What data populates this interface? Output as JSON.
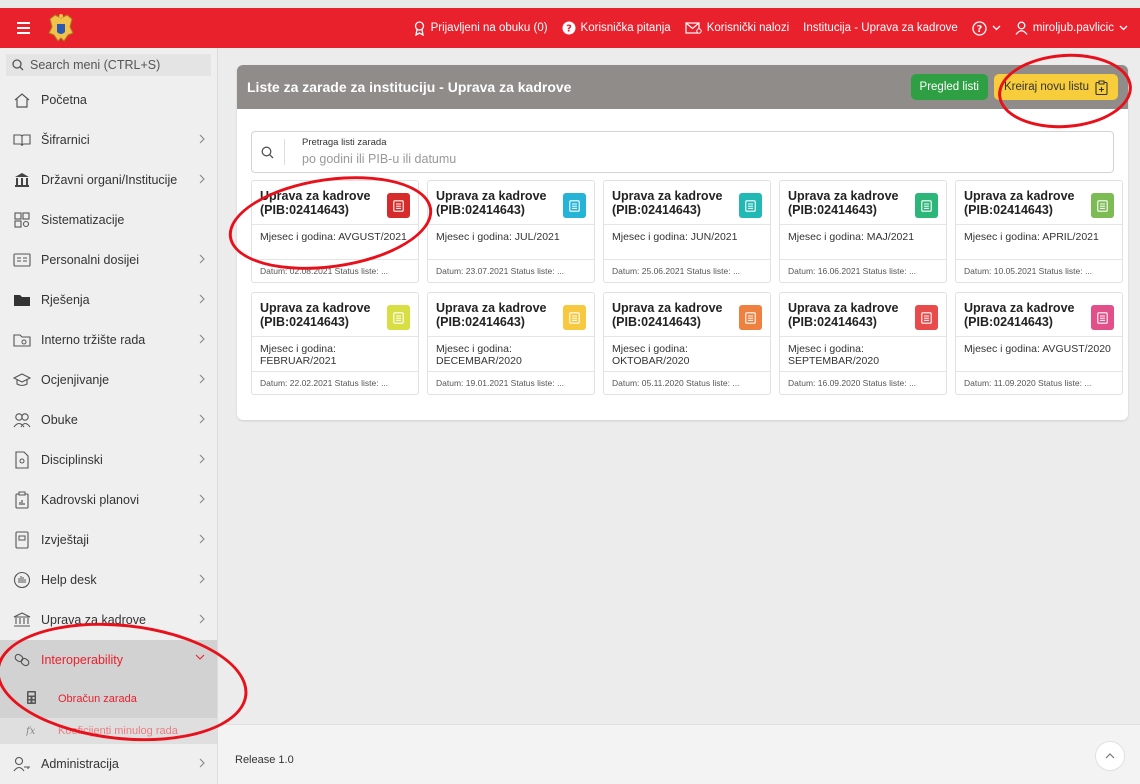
{
  "topbar": {
    "links": [
      {
        "name": "trainings-link",
        "icon": "award-icon",
        "label": "Prijavljeni na obuku (0)"
      },
      {
        "name": "questions-link",
        "icon": "question-circle-icon",
        "label": "Korisnička pitanja"
      },
      {
        "name": "accounts-link",
        "icon": "user-mail-icon",
        "label": "Korisnički nalozi"
      },
      {
        "name": "institution-link",
        "icon": "",
        "label": "Institucija - Uprava za kadrove"
      }
    ],
    "user": "miroljub.pavlicic"
  },
  "sidebar": {
    "search_placeholder": "Search meni (CTRL+S)",
    "items": [
      {
        "name": "sidebar-item-pocetna",
        "icon": "home-icon",
        "label": "Početna",
        "chevron": false
      },
      {
        "name": "sidebar-item-sifrarnici",
        "icon": "book-icon",
        "label": "Šifrarnici",
        "chevron": true
      },
      {
        "name": "sidebar-item-drzavni-organi",
        "icon": "building-icon",
        "label": "Državni organi/Institucije",
        "chevron": true
      },
      {
        "name": "sidebar-item-sistematizacije",
        "icon": "org-search-icon",
        "label": "Sistematizacije",
        "chevron": false
      },
      {
        "name": "sidebar-item-personalni-dosijei",
        "icon": "id-card-icon",
        "label": "Personalni dosijei",
        "chevron": true
      },
      {
        "name": "sidebar-item-rjesenja",
        "icon": "folder-icon",
        "label": "Rješenja",
        "chevron": true
      },
      {
        "name": "sidebar-item-interno-trziste",
        "icon": "folder-search-icon",
        "label": "Interno tržište rada",
        "chevron": true
      },
      {
        "name": "sidebar-item-ocjenjivanje",
        "icon": "graduation-icon",
        "label": "Ocjenjivanje",
        "chevron": true
      },
      {
        "name": "sidebar-item-obuke",
        "icon": "users-icon",
        "label": "Obuke",
        "chevron": true
      },
      {
        "name": "sidebar-item-disciplinski",
        "icon": "doc-user-icon",
        "label": "Disciplinski",
        "chevron": true
      },
      {
        "name": "sidebar-item-kadrovski-planovi",
        "icon": "clipboard-chart-icon",
        "label": "Kadrovski planovi",
        "chevron": true
      },
      {
        "name": "sidebar-item-izvjestaji",
        "icon": "report-icon",
        "label": "Izvještaji",
        "chevron": true
      },
      {
        "name": "sidebar-item-help-desk",
        "icon": "help-hand-icon",
        "label": "Help desk",
        "chevron": true
      },
      {
        "name": "sidebar-item-uprava-za-kadrove",
        "icon": "bank-icon",
        "label": "Uprava za kadrove",
        "chevron": true
      },
      {
        "name": "sidebar-item-interoperability",
        "icon": "link-icon",
        "label": "Interoperability",
        "chevron": true,
        "active": true
      },
      {
        "name": "sidebar-item-administracija",
        "icon": "user-key-icon",
        "label": "Administracija",
        "chevron": true
      }
    ],
    "sub_items": [
      "Obračun zarada",
      "Koeficijenti minulog rada"
    ]
  },
  "panel": {
    "title": "Liste za zarade za instituciju - Uprava za kadrove",
    "btn_pregled": "Pregled listi",
    "btn_kreiraj": "Kreiraj novu listu",
    "search_label": "Pretraga listi zarada",
    "search_placeholder": "po godini ili PIB-u ili datumu"
  },
  "cards": [
    {
      "title": "Uprava za kadrove (PIB:02414643)",
      "month": "Mjesec i godina: AVGUST/2021",
      "date": "Datum: 02.08.2021 Status liste: ...",
      "color": "#d62b2b"
    },
    {
      "title": "Uprava za kadrove (PIB:02414643)",
      "month": "Mjesec i godina: JUL/2021",
      "date": "Datum: 23.07.2021 Status liste: ...",
      "color": "#26b3d8"
    },
    {
      "title": "Uprava za kadrove (PIB:02414643)",
      "month": "Mjesec i godina: JUN/2021",
      "date": "Datum: 25.06.2021 Status liste: ...",
      "color": "#22b9b5"
    },
    {
      "title": "Uprava za kadrove (PIB:02414643)",
      "month": "Mjesec i godina: MAJ/2021",
      "date": "Datum: 16.06.2021 Status liste: ...",
      "color": "#2db67a"
    },
    {
      "title": "Uprava za kadrove (PIB:02414643)",
      "month": "Mjesec i godina: APRIL/2021",
      "date": "Datum: 10.05.2021 Status liste: ...",
      "color": "#7dbb54"
    },
    {
      "title": "Uprava za kadrove (PIB:02414643)",
      "month": "Mjesec i godina: FEBRUAR/2021",
      "date": "Datum: 22.02.2021 Status liste: ...",
      "color": "#d7df45"
    },
    {
      "title": "Uprava za kadrove (PIB:02414643)",
      "month": "Mjesec i godina: DECEMBAR/2020",
      "date": "Datum: 19.01.2021 Status liste: ...",
      "color": "#f6c940"
    },
    {
      "title": "Uprava za kadrove (PIB:02414643)",
      "month": "Mjesec i godina: OKTOBAR/2020",
      "date": "Datum: 05.11.2020 Status liste: ...",
      "color": "#ee8140"
    },
    {
      "title": "Uprava za kadrove (PIB:02414643)",
      "month": "Mjesec i godina: SEPTEMBAR/2020",
      "date": "Datum: 16.09.2020 Status liste: ...",
      "color": "#e84b4b"
    },
    {
      "title": "Uprava za kadrove (PIB:02414643)",
      "month": "Mjesec i godina: AVGUST/2020",
      "date": "Datum: 11.09.2020 Status liste: ...",
      "color": "#e2508a"
    }
  ],
  "footer": {
    "release": "Release 1.0"
  }
}
